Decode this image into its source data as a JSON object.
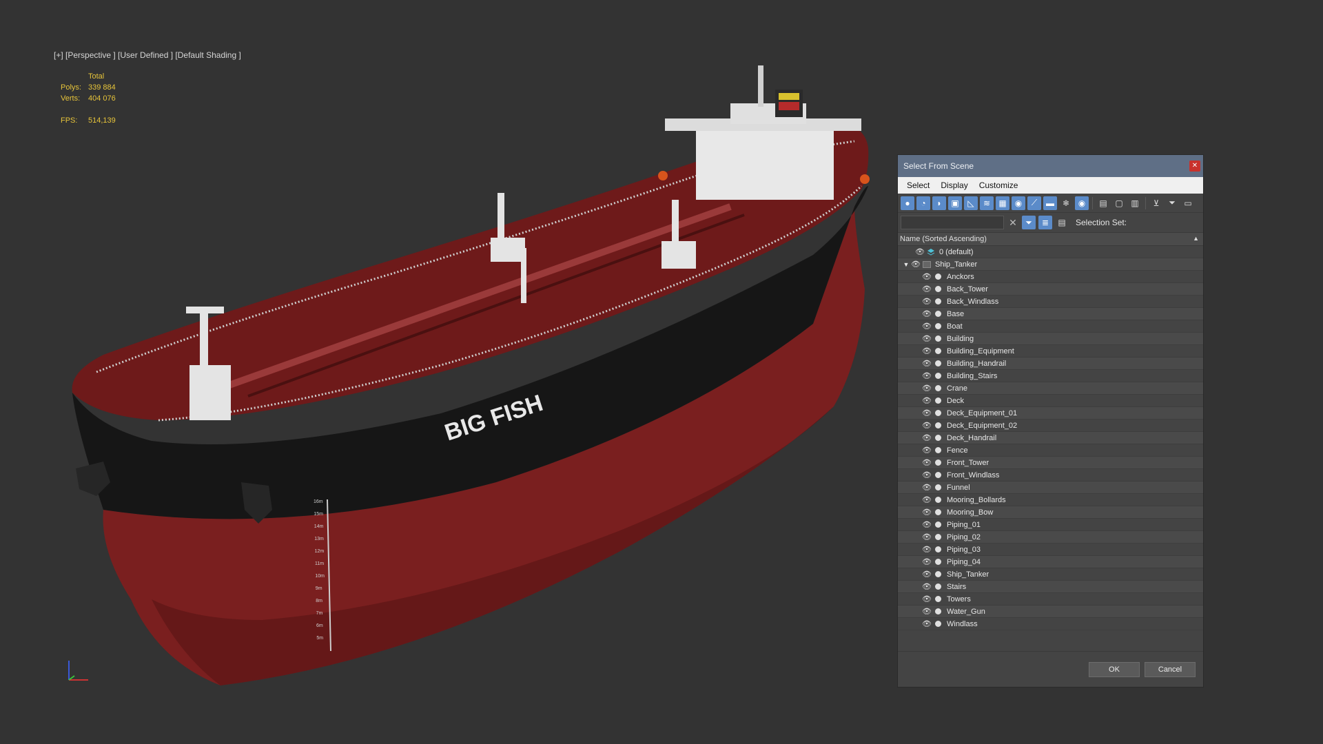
{
  "viewport": {
    "label": "[+] [Perspective ] [User Defined ] [Default Shading ]",
    "stats": {
      "total_label": "Total",
      "polys_label": "Polys:",
      "polys_value": "339 884",
      "verts_label": "Verts:",
      "verts_value": "404 076",
      "fps_label": "FPS:",
      "fps_value": "514,139"
    },
    "ship_name": "BIG FISH",
    "draft_marks": [
      "16m",
      "15m",
      "14m",
      "13m",
      "12m",
      "11m",
      "10m",
      "9m",
      "8m",
      "7m",
      "6m",
      "5m"
    ]
  },
  "dialog": {
    "title": "Select From Scene",
    "close_icon": "close-icon",
    "menu": [
      "Select",
      "Display",
      "Customize"
    ],
    "search_placeholder": "",
    "selection_set_label": "Selection Set:",
    "column_header": "Name (Sorted Ascending)",
    "tree": {
      "default_layer": "0 (default)",
      "group": "Ship_Tanker",
      "items": [
        "Anckors",
        "Back_Tower",
        "Back_Windlass",
        "Base",
        "Boat",
        "Building",
        "Building_Equipment",
        "Building_Handrail",
        "Building_Stairs",
        "Crane",
        "Deck",
        "Deck_Equipment_01",
        "Deck_Equipment_02",
        "Deck_Handrail",
        "Fence",
        "Front_Tower",
        "Front_Windlass",
        "Funnel",
        "Mooring_Bollards",
        "Mooring_Bow",
        "Piping_01",
        "Piping_02",
        "Piping_03",
        "Piping_04",
        "Ship_Tanker",
        "Stairs",
        "Towers",
        "Water_Gun",
        "Windlass"
      ]
    },
    "ok_label": "OK",
    "cancel_label": "Cancel"
  },
  "colors": {
    "viewport_bg": "#333333",
    "title_bar": "#5f6f86",
    "close": "#c8312c",
    "hull_red": "#7a1f1f",
    "deck_red": "#6e1a1a",
    "hull_black": "#161616",
    "stats_yellow": "#e8c53a",
    "toggle_active": "#5b8bc9"
  }
}
